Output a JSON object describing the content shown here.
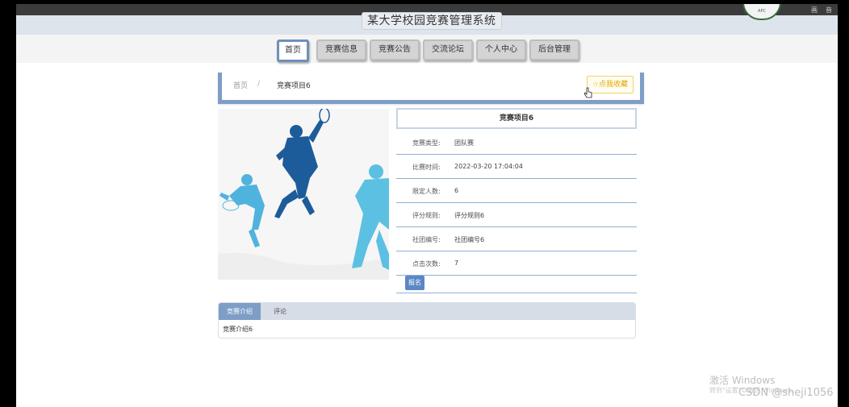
{
  "window": {
    "ctrl_1": "画",
    "ctrl_2": "音",
    "ctrl_3": "字"
  },
  "header": {
    "site_title": "某大学校园竞赛管理系统",
    "logo_text": "APC"
  },
  "nav": {
    "items": [
      {
        "label": "首页",
        "active": true
      },
      {
        "label": "竞赛信息"
      },
      {
        "label": "竞赛公告"
      },
      {
        "label": "交流论坛"
      },
      {
        "label": "个人中心"
      },
      {
        "label": "后台管理"
      }
    ]
  },
  "breadcrumb": {
    "home": "首页",
    "separator": "/",
    "current": "竞赛项目6"
  },
  "favorite": {
    "icon": "star-icon",
    "label": "☆点我收藏"
  },
  "detail": {
    "title": "竞赛项目6",
    "rows": [
      {
        "label": "竞赛类型:",
        "value": "团队赛"
      },
      {
        "label": "比赛时间:",
        "value": "2022-03-20 17:04:04"
      },
      {
        "label": "限定人数:",
        "value": "6"
      },
      {
        "label": "评分规则:",
        "value": "评分规则6"
      },
      {
        "label": "社团编号:",
        "value": "社团编号6"
      },
      {
        "label": "点击次数:",
        "value": "7"
      }
    ],
    "signup_label": "报名"
  },
  "tabs": {
    "items": [
      {
        "label": "竞赛介绍",
        "active": true
      },
      {
        "label": "评论"
      }
    ],
    "content": "竞赛介绍6"
  },
  "overlay": {
    "activation_title": "激活 Windows",
    "activation_sub": "转到\"设置\"以激活 Windows。",
    "csdn": "CSDN @sheji1056"
  },
  "colors": {
    "accent": "#7e9ec6",
    "button_blue": "#5b87c5",
    "favorite": "#e0a800"
  }
}
